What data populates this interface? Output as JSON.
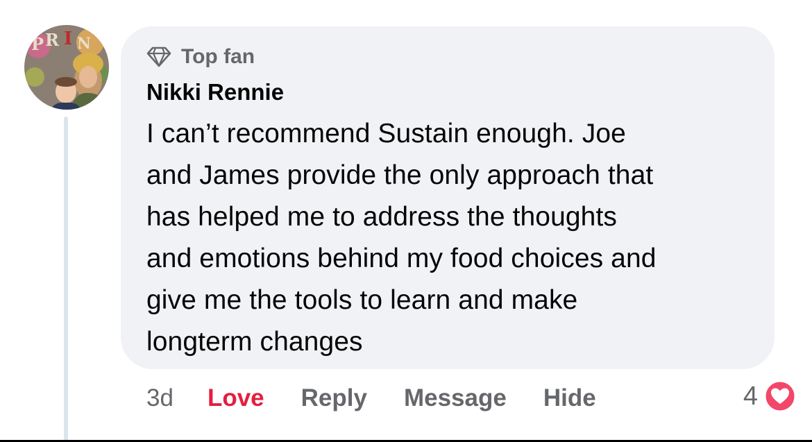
{
  "comment": {
    "badge": {
      "icon": "diamond-icon",
      "label": "Top fan"
    },
    "author": "Nikki Rennie",
    "text": "I can’t recommend Sustain enough. Joe\nand James provide the only approach that\nhas helped me to address the thoughts\nand emotions behind my food choices and\ngive me the tools to learn and make\nlongterm changes",
    "avatar": {
      "icon": "user-avatar",
      "lettering": "PRIN"
    }
  },
  "actions": {
    "time": "3d",
    "love": "Love",
    "reply": "Reply",
    "message": "Message",
    "hide": "Hide"
  },
  "reactions": {
    "count": "4",
    "icon": "heart-reaction-icon"
  },
  "colors": {
    "bubble": "#f0f2f5",
    "secondary_text": "#65676b",
    "love": "#e41e3f",
    "thread_line": "#dbe6ec"
  }
}
